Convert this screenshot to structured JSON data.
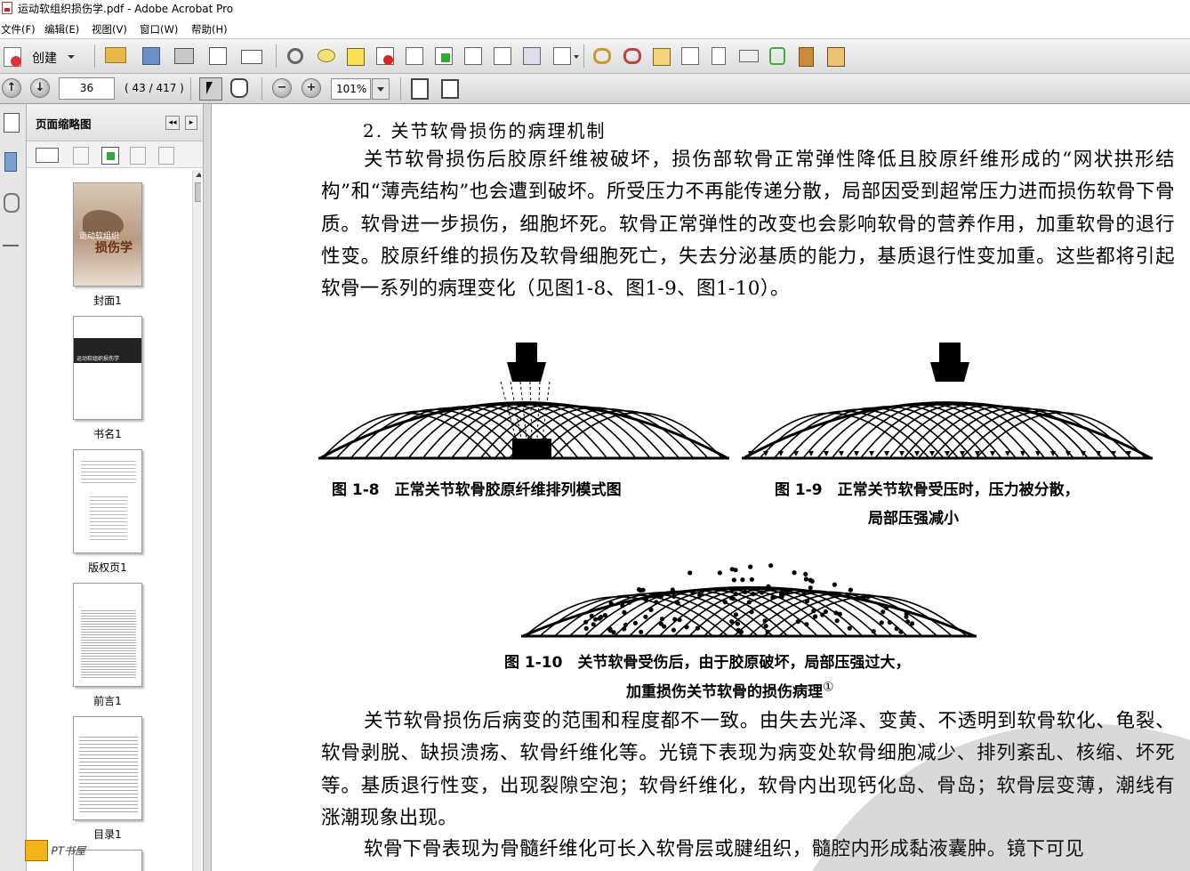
{
  "window": {
    "title": "运动软组织损伤学.pdf - Adobe Acrobat Pro"
  },
  "menu": [
    "文件(F)",
    "编辑(E)",
    "视图(V)",
    "窗口(W)",
    "帮助(H)"
  ],
  "toolbar": {
    "create_label": "创建"
  },
  "nav": {
    "page_input": "36",
    "page_count": "( 43 / 417 )",
    "zoom": "101%"
  },
  "panel": {
    "title": "页面缩略图",
    "thumbnails": [
      {
        "label": "封面1",
        "cover_text": "损伤学",
        "cover_sub": "运动软组织"
      },
      {
        "label": "书名1",
        "band_text": "运动软组织损伤学"
      },
      {
        "label": "版权页1"
      },
      {
        "label": "前言1"
      },
      {
        "label": "目录1"
      }
    ]
  },
  "document": {
    "heading": "2. 关节软骨损伤的病理机制",
    "para1": "关节软骨损伤后胶原纤维被破坏，损伤部软骨正常弹性降低且胶原纤维形成的“网状拱形结构”和“薄壳结构”也会遭到破坏。所受压力不再能传递分散，局部因受到超常压力进而损伤软骨下骨质。软骨进一步损伤，细胞坏死。软骨正常弹性的改变也会影响软骨的营养作用，加重软骨的退行性变。胶原纤维的损伤及软骨细胞死亡，失去分泌基质的能力，基质退行性变加重。这些都将引起软骨一系列的病理变化（见图1-8、图1-9、图1-10）。",
    "fig8_caption": "图 1-8　正常关节软骨胶原纤维排列模式图",
    "fig9_caption_1": "图 1-9　正常关节软骨受压时，压力被分散，",
    "fig9_caption_2": "局部压强减小",
    "fig10_caption_1": "图 1-10　关节软骨受伤后，由于胶原破坏，局部压强过大，",
    "fig10_caption_2": "加重损伤关节软骨的损伤病理",
    "fig10_note": "①",
    "para2": "关节软骨损伤后病变的范围和程度都不一致。由失去光泽、变黄、不透明到软骨软化、龟裂、软骨剥脱、缺损溃疡、软骨纤维化等。光镜下表现为病变处软骨细胞减少、排列紊乱、核缩、坏死等。基质退行性变，出现裂隙空泡；软骨纤维化，软骨内出现钙化岛、骨岛；软骨层变薄，潮线有涨潮现象出现。",
    "para3": "软骨下骨表现为骨髓纤维化可长入软骨层或腱组织，髓腔内形成黏液囊肿。镜下可见"
  },
  "logo_text": "PT书屋"
}
